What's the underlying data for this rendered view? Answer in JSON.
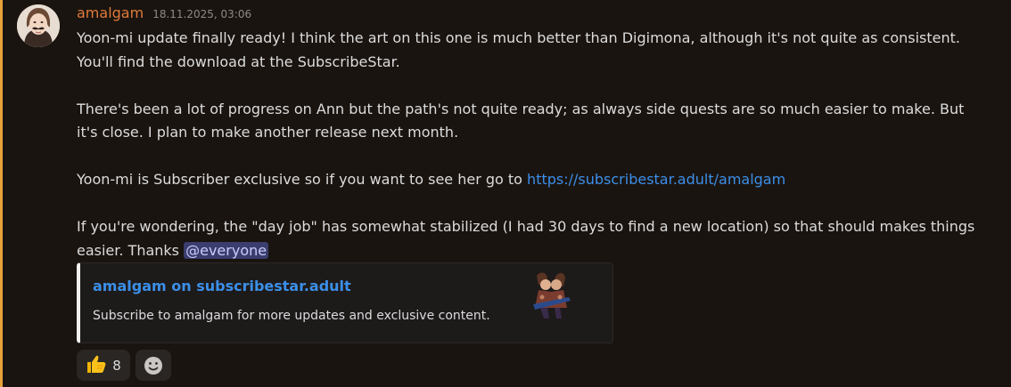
{
  "author": {
    "name": "amalgam",
    "timestamp": "18.11.2025, 03:06",
    "name_color": "#e07b39",
    "avatar_icon": "user-avatar"
  },
  "message": {
    "p1_line1": "Yoon-mi update finally ready! I think the art on this one is much better than Digimona, although it's not quite as consistent.",
    "p1_line2": "You'll find the download at the SubscribeStar.",
    "p2_line1": "There's been a lot of progress on Ann but the path's not quite ready; as always side quests are so much easier to make. But",
    "p2_line2": "it's close. I plan to make another release next month.",
    "p3_text": "Yoon-mi is Subscriber exclusive so if you want to see her go to ",
    "p3_link": "https://subscribestar.adult/amalgam",
    "p4_line1": "If you're wondering, the \"day job\" has somewhat stabilized (I had 30 days to find a new location) so that should makes things",
    "p4_line2": "easier. Thanks ",
    "mention": "@everyone"
  },
  "embed": {
    "title": "amalgam on subscribestar.adult",
    "description": "Subscribe to amalgam for more updates and exclusive content.",
    "accent_color": "#f0f0f0",
    "thumbnail_icon": "subscribestar-thumbnail"
  },
  "reactions": [
    {
      "emoji": "👍",
      "icon": "thumbs-up-icon",
      "count": "8"
    },
    {
      "icon": "add-reaction-icon"
    }
  ],
  "colors": {
    "background": "#1a1410",
    "mention_bar": "#e8a23a",
    "link": "#3b8fe8",
    "mention_bg": "#3a3d6e"
  }
}
